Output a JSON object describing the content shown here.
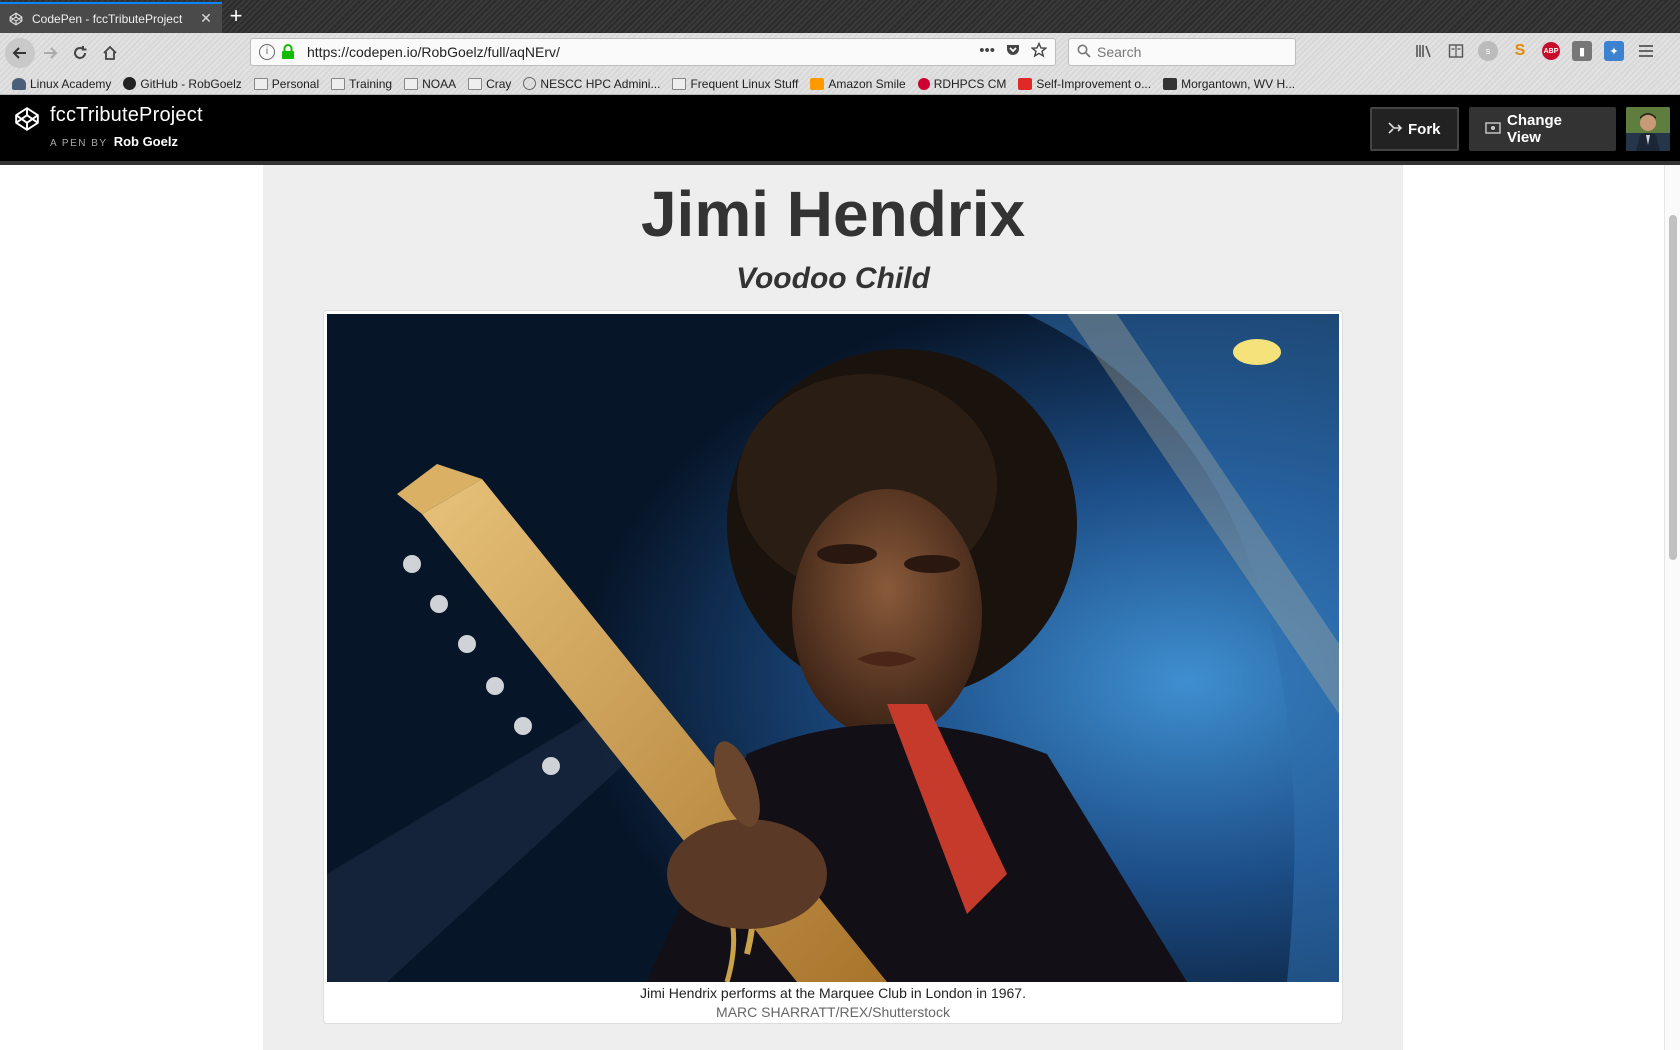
{
  "browser": {
    "tab": {
      "title": "CodePen - fccTributeProject",
      "close_label": "✕"
    },
    "new_tab_label": "+",
    "url": "https://codepen.io/RobGoelz/full/aqNErv/",
    "url_actions": [
      "•••"
    ],
    "search_placeholder": "Search",
    "toolbar_icons": [
      "library-icon",
      "reader-view-icon",
      "extension-icon",
      "slack-icon",
      "adblock-plus-icon",
      "extension-gray-icon",
      "extension-blue-icon",
      "menu-icon"
    ],
    "abp_label": "ABP"
  },
  "bookmarks": [
    {
      "label": "Linux Academy",
      "icon": "la"
    },
    {
      "label": "GitHub - RobGoelz",
      "icon": "github"
    },
    {
      "label": "Personal",
      "icon": "folder"
    },
    {
      "label": "Training",
      "icon": "folder"
    },
    {
      "label": "NOAA",
      "icon": "folder"
    },
    {
      "label": "Cray",
      "icon": "folder"
    },
    {
      "label": "NESCC HPC Admini...",
      "icon": "globe"
    },
    {
      "label": "Frequent Linux Stuff",
      "icon": "folder"
    },
    {
      "label": "Amazon Smile",
      "icon": "amazon"
    },
    {
      "label": "RDHPCS CM",
      "icon": "noaa"
    },
    {
      "label": "Self-Improvement o...",
      "icon": "flip"
    },
    {
      "label": "Morgantown, WV H...",
      "icon": "wv"
    }
  ],
  "codepen": {
    "pen_title": "fccTributeProject",
    "byline_prefix": "A PEN BY",
    "author": "Rob Goelz",
    "fork_label": "Fork",
    "change_view_label": "Change View"
  },
  "page": {
    "title": "Jimi Hendrix",
    "subtitle": "Voodoo Child",
    "image_caption": "Jimi Hendrix performs at the Marquee Club in London in 1967.",
    "image_credit": "MARC SHARRATT/REX/Shutterstock"
  },
  "colors": {
    "tab_accent": "#0a84ff",
    "codepen_header": "#000000",
    "content_bg": "#eeeeee",
    "heading": "#333333"
  }
}
